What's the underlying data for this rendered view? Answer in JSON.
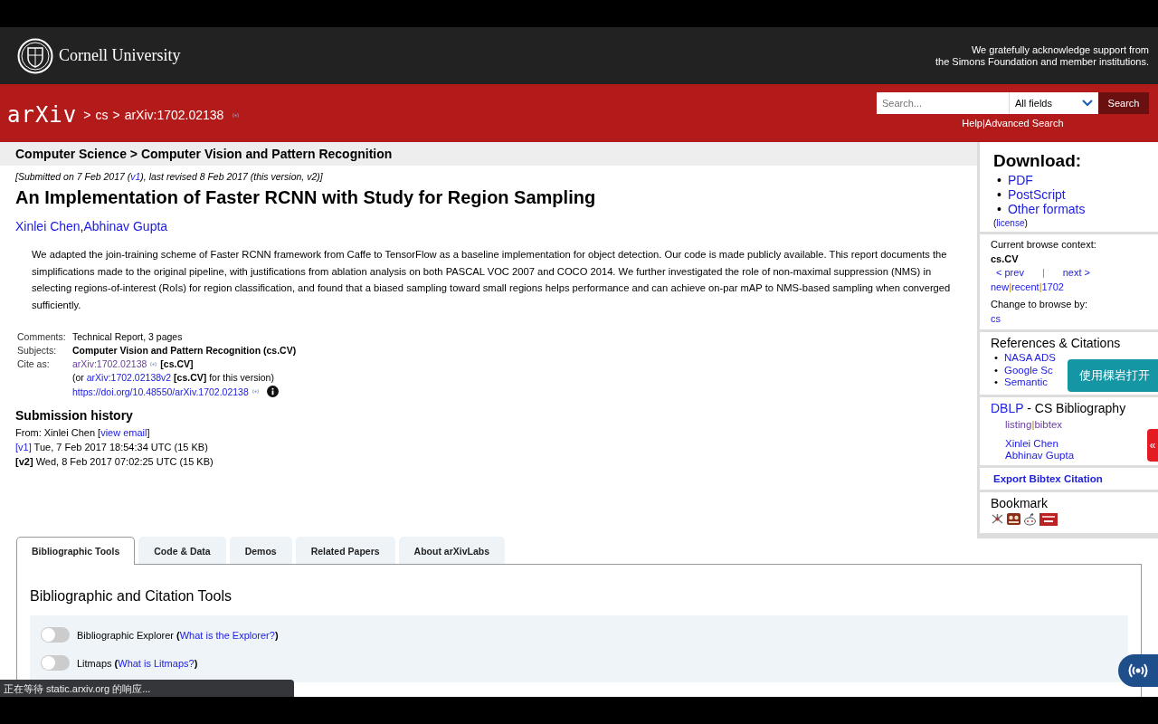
{
  "separators": {
    "crumb": ">",
    "bar": "|",
    "comma": ",",
    "open": "(",
    "close": ")",
    "bullet": "•"
  },
  "header": {
    "institution": "Cornell University",
    "acknowledgement": [
      "We gratefully acknowledge support from",
      "the Simons Foundation and member institutions."
    ]
  },
  "nav": {
    "logo": "arXiv",
    "crumbs": [
      "cs",
      "arXiv:1702.02138"
    ],
    "search": {
      "placeholder": "Search...",
      "field": "All fields",
      "button": "Search"
    },
    "links": [
      "Help",
      "Advanced Search"
    ]
  },
  "subheader": "Computer Science > Computer Vision and Pattern Recognition",
  "paper": {
    "dateline": {
      "before": "[Submitted on 7 Feb 2017 (",
      "link": "v1",
      "after": "), last revised 8 Feb 2017 (this version, v2)]"
    },
    "title": "An Implementation of Faster RCNN with Study for Region Sampling",
    "authors": [
      "Xinlei Chen",
      "Abhinav Gupta"
    ],
    "abstract": "We adapted the join-training scheme of Faster RCNN framework from Caffe to TensorFlow as a baseline implementation for object detection. Our code is made publicly available. This report documents the simplifications made to the original pipeline, with justifications from ablation analysis on both PASCAL VOC 2007 and COCO 2014. We further investigated the role of non-maximal suppression (NMS) in selecting regions-of-interest (RoIs) for region classification, and found that a biased sampling toward small regions helps performance and can achieve on-par mAP to NMS-based sampling when converged sufficiently.",
    "metadata": [
      {
        "label": "Comments:",
        "value": "Technical Report, 3 pages",
        "bold": false
      },
      {
        "label": "Subjects:",
        "value": "Computer Vision and Pattern Recognition (cs.CV)",
        "bold": true
      }
    ],
    "cite": {
      "label": "Cite as:",
      "id": "arXiv:1702.02138",
      "category": "[cs.CV]",
      "alt_before": "(or ",
      "alt_id": "arXiv:1702.02138v2",
      "alt_after": " **[cs.CV]** for this version)",
      "doi": "https://doi.org/10.48550/arXiv.1702.02138"
    },
    "history": {
      "title": "Submission history",
      "from": "From: Xinlei Chen [",
      "email": "view email",
      "from_after": "]",
      "versions": [
        {
          "version": "[v1]",
          "current": false,
          "date": "Tue, 7 Feb 2017 18:54:34 UTC (15 KB)"
        },
        {
          "version": "[v2]",
          "current": true,
          "date": "Wed, 8 Feb 2017 07:02:25 UTC (15 KB)"
        }
      ]
    }
  },
  "sidebar": {
    "download": {
      "title": "Download:",
      "links": [
        "PDF",
        "PostScript",
        "Other formats"
      ],
      "license": "license"
    },
    "browse": {
      "label": "Current browse context:",
      "context": "cs.CV",
      "prev": "< prev",
      "next": "next >",
      "lists": [
        "new",
        "recent",
        "1702"
      ],
      "change_label": "Change to browse by:",
      "change": [
        "cs"
      ]
    },
    "references": {
      "title": "References & Citations",
      "links": [
        "NASA ADS",
        "Google Sc",
        "Semantic"
      ]
    },
    "dblp": {
      "link": "DBLP",
      "title": " - CS Bibliography",
      "links": [
        "listing",
        "bibtex"
      ],
      "authors": [
        "Xinlei Chen",
        "Abhinav Gupta"
      ]
    },
    "export": "Export Bibtex Citation",
    "bookmark": "Bookmark"
  },
  "tabs": [
    {
      "label": "Bibliographic Tools",
      "selected": true
    },
    {
      "label": "Code & Data",
      "selected": false
    },
    {
      "label": "Demos",
      "selected": false
    },
    {
      "label": "Related Papers",
      "selected": false
    },
    {
      "label": "About arXivLabs",
      "selected": false
    }
  ],
  "panel": {
    "title": "Bibliographic and Citation Tools",
    "toggles": [
      {
        "label": "Bibliographic Explorer",
        "link": "What is the Explorer?",
        "checked": false
      },
      {
        "label": "Litmaps",
        "link": "What is Litmaps?",
        "checked": false
      }
    ]
  },
  "overlays": {
    "open_button": "使用棵岩打开",
    "side_tab": "«",
    "status": "正在等待 static.arxiv.org 的响应..."
  }
}
